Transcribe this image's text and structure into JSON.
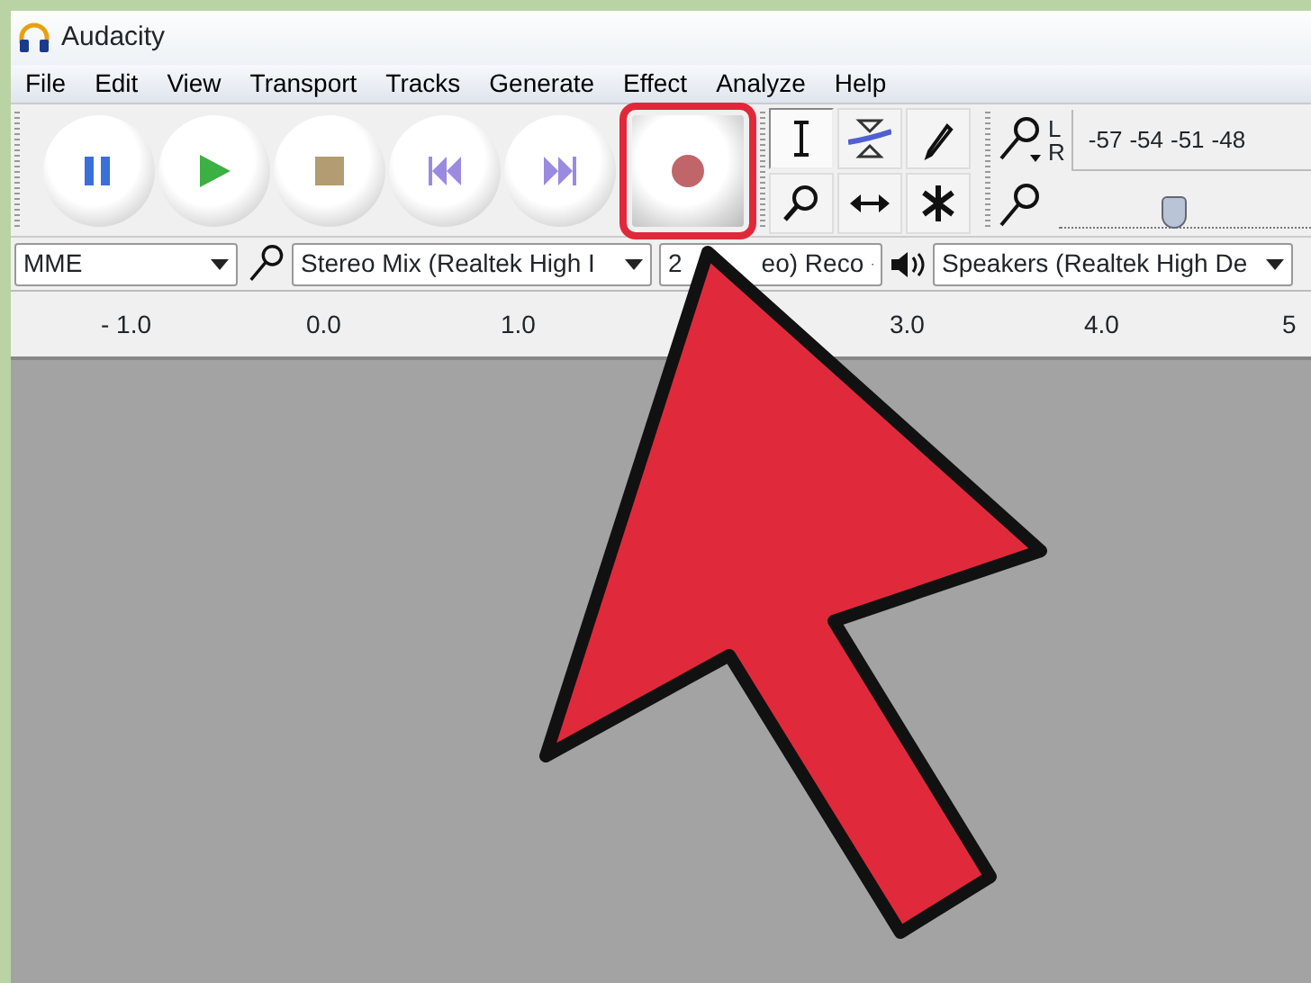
{
  "window": {
    "title": "Audacity"
  },
  "menu": [
    "File",
    "Edit",
    "View",
    "Transport",
    "Tracks",
    "Generate",
    "Effect",
    "Analyze",
    "Help"
  ],
  "transport": [
    {
      "kind": "pause",
      "highlighted": false
    },
    {
      "kind": "play",
      "highlighted": false
    },
    {
      "kind": "stop",
      "highlighted": false
    },
    {
      "kind": "skip-start",
      "highlighted": false
    },
    {
      "kind": "skip-end",
      "highlighted": false
    },
    {
      "kind": "record",
      "highlighted": true
    }
  ],
  "tools": [
    {
      "kind": "select",
      "selected": true
    },
    {
      "kind": "envelope",
      "selected": false
    },
    {
      "kind": "draw",
      "selected": false
    },
    {
      "kind": "zoom",
      "selected": false
    },
    {
      "kind": "timeshift",
      "selected": false
    },
    {
      "kind": "multi",
      "selected": false
    }
  ],
  "meter": {
    "channels": [
      "L",
      "R"
    ],
    "ticks": [
      "-57",
      "-54",
      "-51",
      "-48"
    ],
    "input_volume": {
      "level": 0.45
    }
  },
  "devices": {
    "host": "MME",
    "input": "Stereo Mix (Realtek High I",
    "channels": [
      "2",
      "eo) Reco"
    ],
    "output": "Speakers (Realtek High De"
  },
  "ruler": [
    "- 1.0",
    "0.0",
    "1.0",
    "3.0",
    "4.0",
    "5"
  ]
}
